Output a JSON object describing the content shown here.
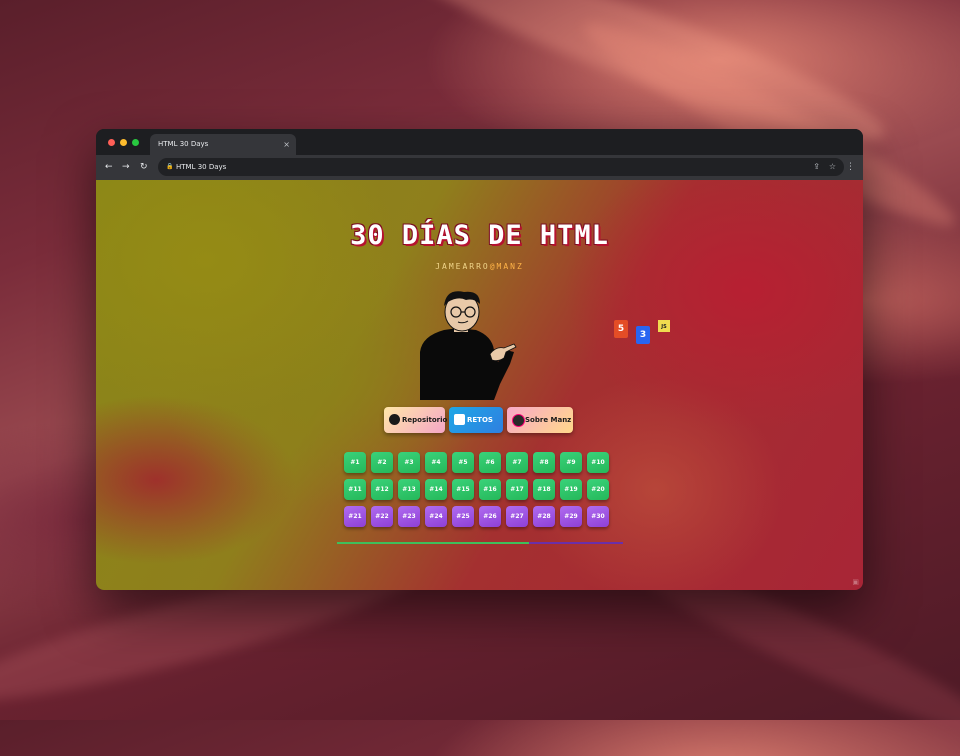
{
  "browser": {
    "tab_title": "HTML 30 Days",
    "tab_close": "×",
    "address": "HTML 30 Days",
    "back": "←",
    "forward": "→",
    "reload": "↻",
    "share": "⇪",
    "bookmark": "☆",
    "menu": "⋮",
    "lock": "🔒"
  },
  "page": {
    "title": "30 DÍAS DE HTML",
    "subtitle_author": "JAMEARRO",
    "subtitle_at": "@MANZ",
    "tech_icons": {
      "html": "5",
      "css": "3",
      "js": "JS"
    },
    "buttons": [
      {
        "label": "Repositorio",
        "icon": "github-icon"
      },
      {
        "label": "RETOS",
        "icon": "html5-icon"
      },
      {
        "label": "Sobre Manz",
        "icon": "avatar-icon"
      }
    ],
    "days": [
      "#1",
      "#2",
      "#3",
      "#4",
      "#5",
      "#6",
      "#7",
      "#8",
      "#9",
      "#10",
      "#11",
      "#12",
      "#13",
      "#14",
      "#15",
      "#16",
      "#17",
      "#18",
      "#19",
      "#20",
      "#21",
      "#22",
      "#23",
      "#24",
      "#25",
      "#26",
      "#27",
      "#28",
      "#29",
      "#30"
    ],
    "progress_fraction": 0.67
  },
  "colors": {
    "green_day": "#25b85a",
    "purple_day": "#8e3fd6",
    "progress_done": "#3fbf5b",
    "progress_rest": "#6b2fa8"
  }
}
